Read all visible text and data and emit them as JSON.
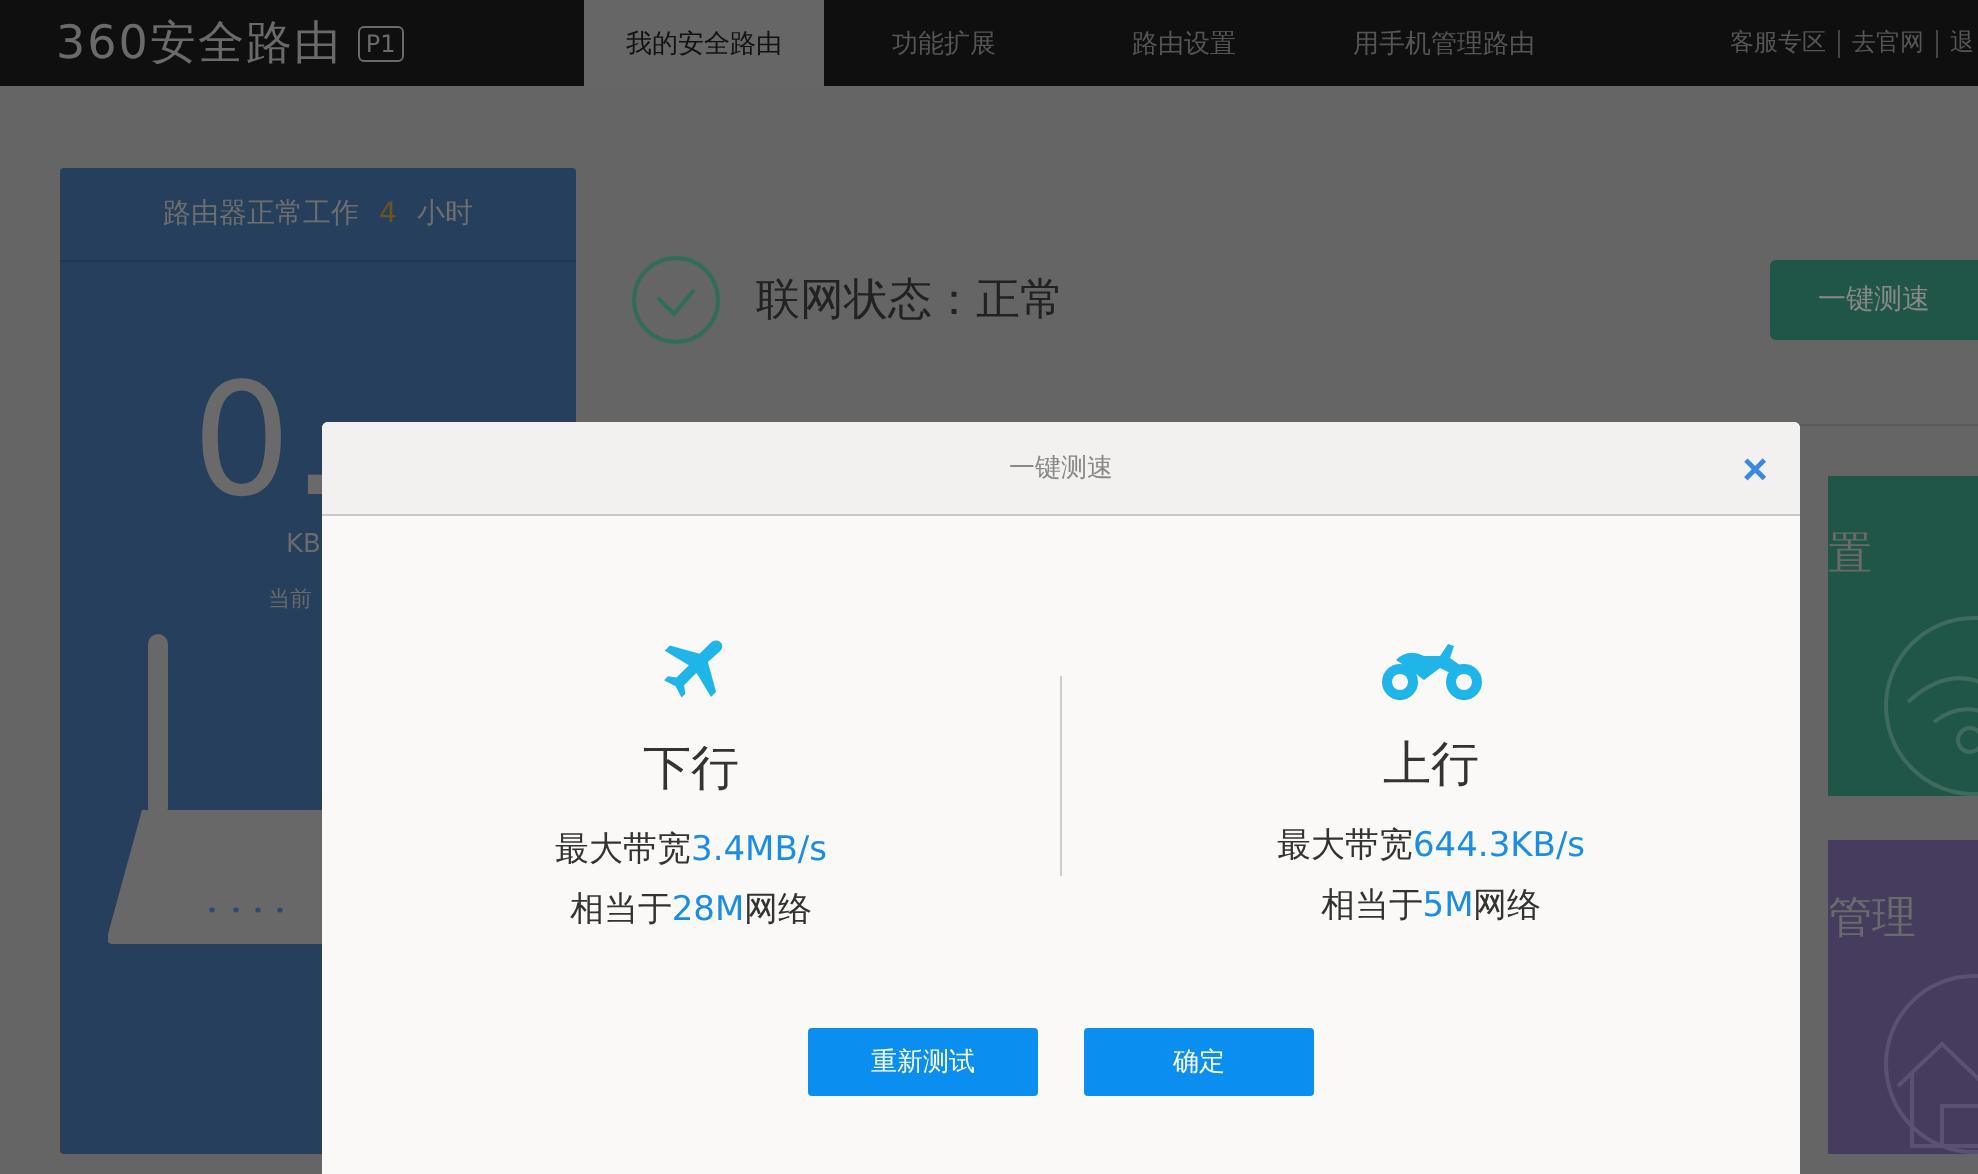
{
  "header": {
    "logo": "360安全路由",
    "model": "P1",
    "tabs": [
      {
        "label": "我的安全路由",
        "selected": true
      },
      {
        "label": "功能扩展",
        "selected": false
      },
      {
        "label": "路由设置",
        "selected": false
      },
      {
        "label": "用手机管理路由",
        "selected": false
      }
    ],
    "links": [
      "客服专区",
      "去官网",
      "退"
    ]
  },
  "status_card": {
    "uptime_prefix": "路由器正常工作",
    "uptime_hours": "4",
    "uptime_suffix": "小时",
    "speed": "0.",
    "unit": "KB",
    "caption": "当前"
  },
  "network": {
    "title": "联网状态：正常",
    "button": "一键测速"
  },
  "tiles": [
    {
      "label": "置",
      "kind": "wifi"
    },
    {
      "label": "管理",
      "kind": "home"
    }
  ],
  "dialog": {
    "title": "一键测速",
    "close": "×",
    "columns": [
      {
        "kind": "plane",
        "title": "下行",
        "bandwidth_label": "最大带宽",
        "bandwidth": "3.4MB/s",
        "equiv_prefix": "相当于",
        "equiv": "28M",
        "equiv_suffix": "网络"
      },
      {
        "kind": "motorcycle",
        "title": "上行",
        "bandwidth_label": "最大带宽",
        "bandwidth": "644.3KB/s",
        "equiv_prefix": "相当于",
        "equiv": "5M",
        "equiv_suffix": "网络"
      }
    ],
    "buttons": [
      "重新测试",
      "确定"
    ]
  }
}
